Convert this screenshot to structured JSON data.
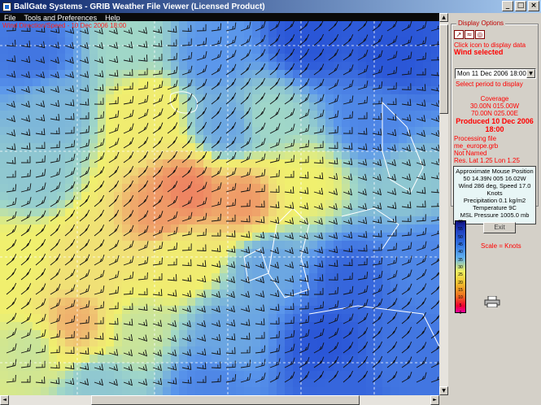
{
  "window": {
    "title": "BallGate Systems - GRIB Weather File Viewer (Licensed Product)"
  },
  "menu": [
    "File",
    "Tools and Preferences",
    "Help"
  ],
  "map": {
    "overlay_title": "Wind Direction/Speed - 10 Dec 2006 18:00"
  },
  "panel": {
    "group_title": "Display Options",
    "icons": [
      "wind-icon",
      "pressure-icon",
      "precipitation-icon"
    ],
    "icon_glyphs": [
      "↗",
      "≈",
      "◎"
    ],
    "click_hint": "Click icon to display data",
    "selected": "Wind selected",
    "period_value": "Mon 11 Dec 2006 18:00",
    "period_hint": "Select period to display",
    "coverage_label": "Coverage",
    "coverage_line1": "30.00N 015.00W",
    "coverage_line2": "70.00N 025.00E",
    "produced": "Produced 10 Dec 2006",
    "produced_time": "18:00",
    "processing_label": "Processing file",
    "file_name": "me_europe.grb",
    "not_named": "Not Named",
    "res": "Res. Lat 1.25 Lon 1.25",
    "mouse_title": "Approximate Mouse Position",
    "mouse_pos": "50 14.39N   005 16.02W",
    "mouse_wind": "Wind 286 deg, Speed 17.0 Knots",
    "mouse_precip": "Precipitation 0.1 kg/m2",
    "mouse_temp": "Temperature 9C",
    "mouse_pressure": "MSL Pressure 1005.0 mb",
    "exit_label": "Exit",
    "scale_label": "Scale = Knots"
  },
  "scale_ticks": [
    "60",
    "55",
    "50",
    "45",
    "40",
    "35",
    "30",
    "25",
    "20",
    "15",
    "10",
    "5",
    "0"
  ],
  "colors": {
    "low": "#1e46d2",
    "mid": "#f0f05a",
    "high": "#ee6e5c"
  }
}
